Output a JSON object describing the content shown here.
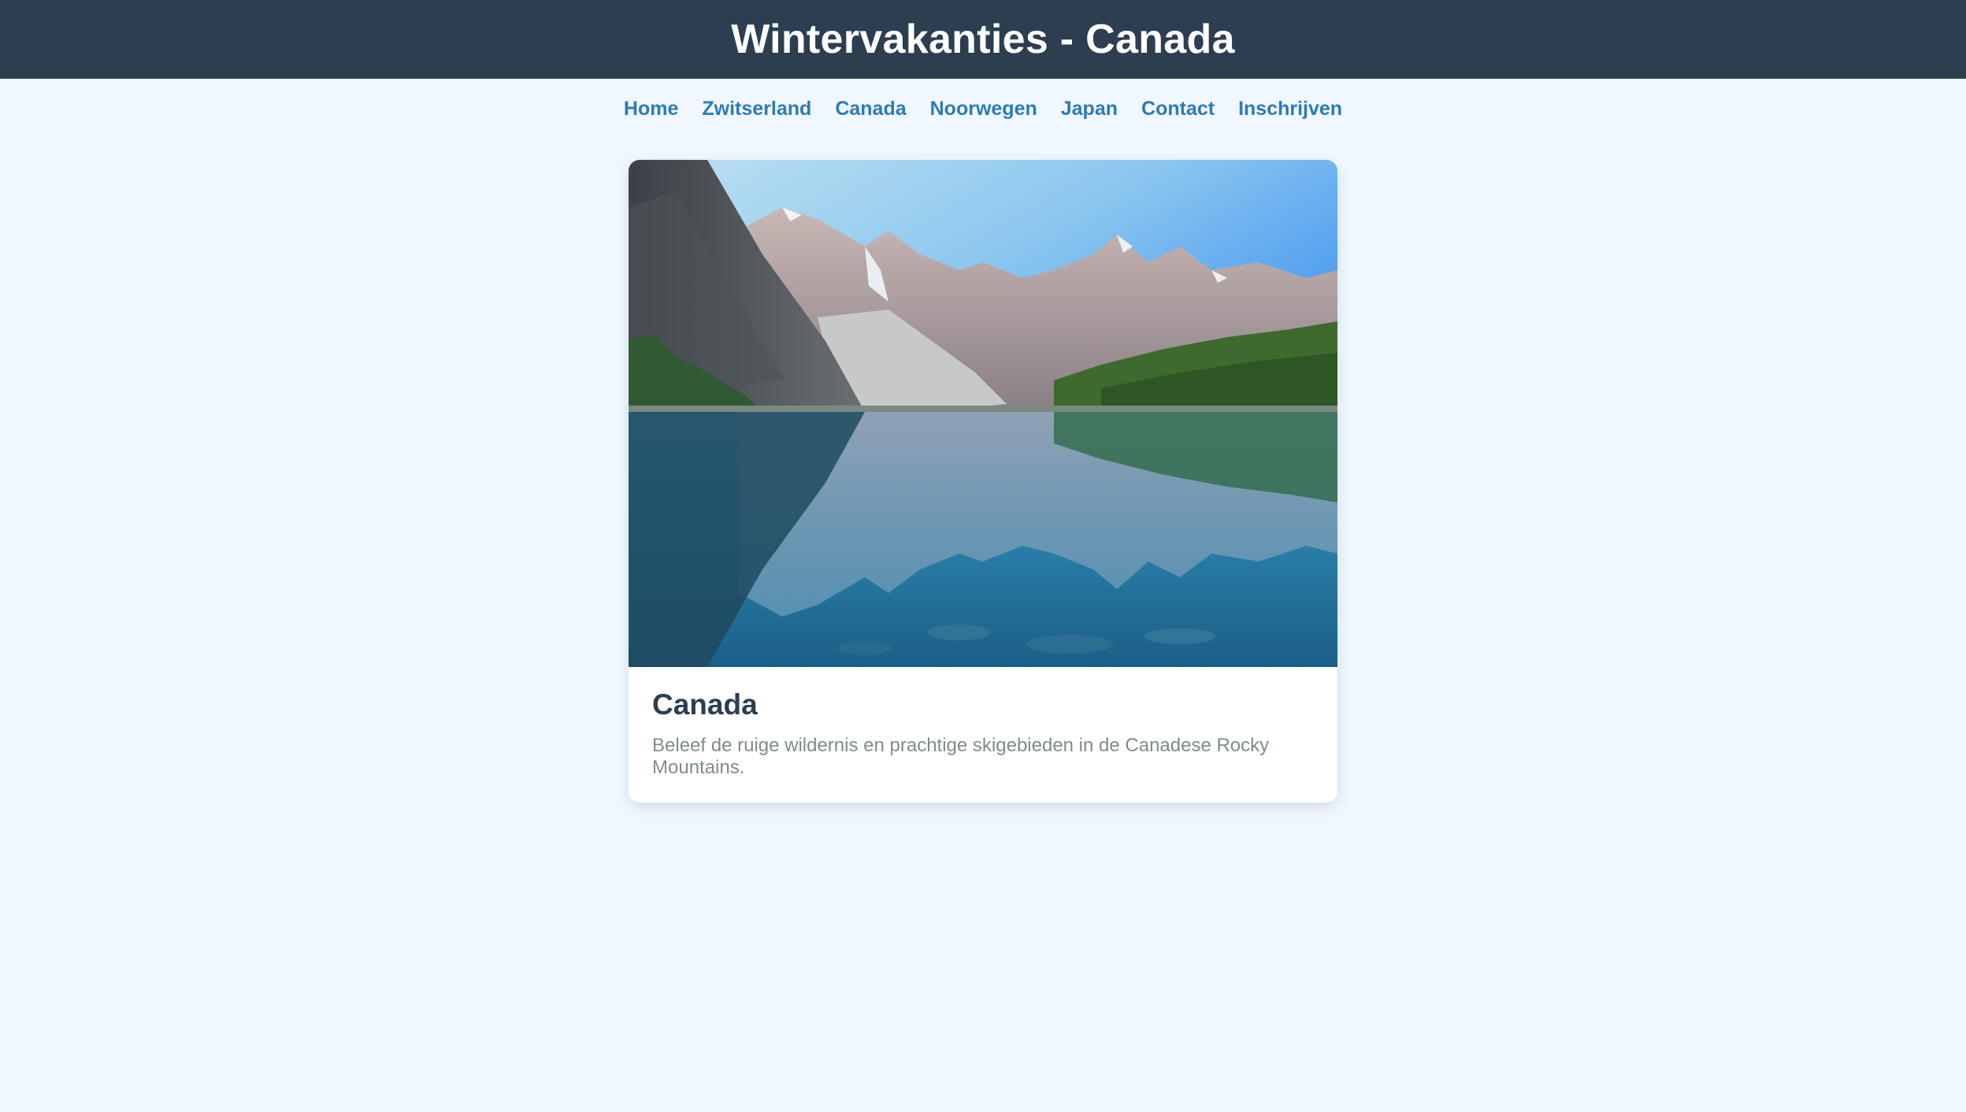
{
  "header": {
    "title": "Wintervakanties - Canada"
  },
  "nav": {
    "items": [
      {
        "label": "Home"
      },
      {
        "label": "Zwitserland"
      },
      {
        "label": "Canada"
      },
      {
        "label": "Noorwegen"
      },
      {
        "label": "Japan"
      },
      {
        "label": "Contact"
      },
      {
        "label": "Inschrijven"
      }
    ]
  },
  "card": {
    "title": "Canada",
    "description": "Beleef de ruige wildernis en prachtige skigebieden in de Canadese Rocky Mountains."
  },
  "colors": {
    "header_bg": "#2c3e50",
    "nav_link": "#2b7bb9",
    "page_bg": "#f0f7ff",
    "card_title": "#2c3e50",
    "card_text": "#7f8c8d"
  }
}
